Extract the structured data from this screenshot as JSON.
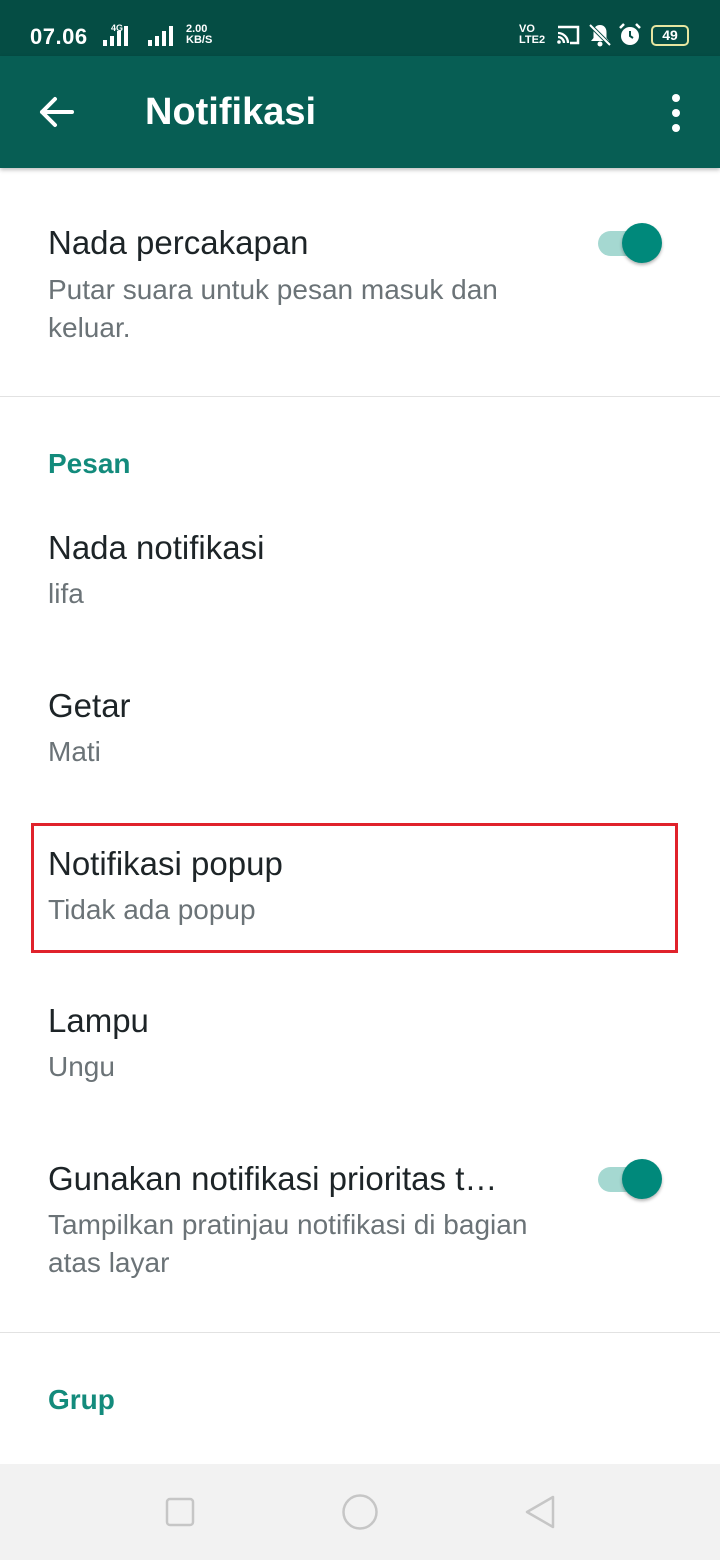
{
  "status_bar": {
    "time": "07.06",
    "network_type": "4G",
    "net_speed_value": "2.00",
    "net_speed_unit": "KB/S",
    "volte_top": "VO",
    "volte_bottom": "LTE2",
    "battery_level": "49",
    "icons": [
      "signal-icon",
      "signal-icon",
      "cast-icon",
      "bell-off-icon",
      "alarm-icon",
      "battery-icon"
    ]
  },
  "app_bar": {
    "title": "Notifikasi",
    "back_icon": "arrow-left-icon",
    "menu_icon": "more-vertical-icon"
  },
  "settings": {
    "conversation_tones": {
      "title": "Nada percakapan",
      "subtitle": "Putar suara untuk pesan masuk dan keluar.",
      "enabled": true
    },
    "messages_section": "Pesan",
    "notification_tone": {
      "title": "Nada notifikasi",
      "value": "lifa"
    },
    "vibrate": {
      "title": "Getar",
      "value": "Mati"
    },
    "popup_notification": {
      "title": "Notifikasi popup",
      "value": "Tidak ada popup"
    },
    "light": {
      "title": "Lampu",
      "value": "Ungu"
    },
    "high_priority": {
      "title": "Gunakan notifikasi prioritas t…",
      "subtitle": "Tampilkan pratinjau notifikasi di bagian atas layar",
      "enabled": true
    },
    "groups_section": "Grup"
  },
  "colors": {
    "status_bar": "#054d44",
    "app_bar": "#075e54",
    "accent": "#138b7c",
    "toggle_thumb": "#00897b",
    "toggle_track": "#a5d8d1",
    "highlight": "#e0222b"
  },
  "nav_bar": {
    "icons": [
      "recent-apps-icon",
      "home-icon",
      "back-triangle-icon"
    ]
  }
}
